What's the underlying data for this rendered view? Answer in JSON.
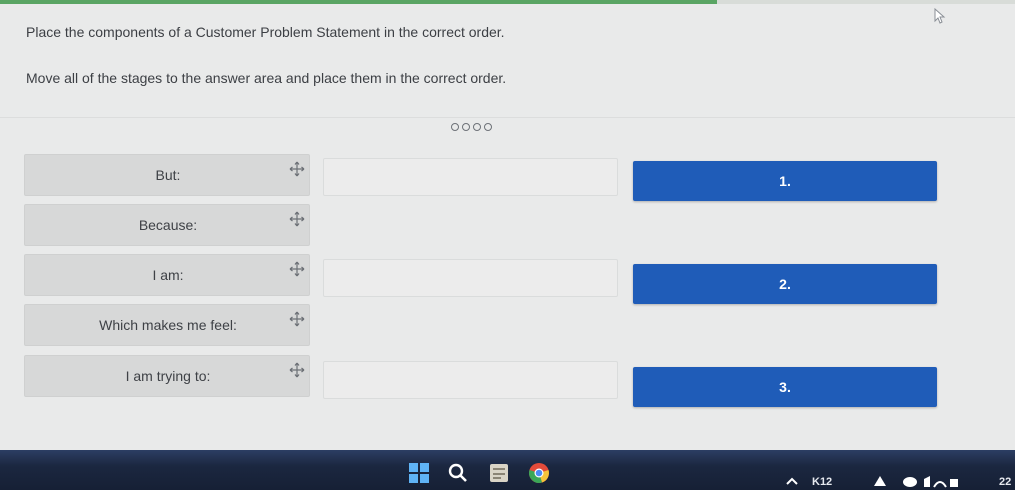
{
  "header": {
    "question": "Place the components of a Customer Problem Statement in the correct order.",
    "instruction": "Move all of the stages to the answer area and place them in the correct order."
  },
  "progress": {
    "fraction": 0.706
  },
  "pager": {
    "dots": 4
  },
  "drag_items": [
    {
      "label": "But:"
    },
    {
      "label": "Because:"
    },
    {
      "label": "I am:"
    },
    {
      "label": "Which makes me feel:"
    },
    {
      "label": "I am trying to:"
    }
  ],
  "answer_slots": [
    {
      "label": "1."
    },
    {
      "label": "2."
    },
    {
      "label": "3."
    }
  ],
  "taskbar": {
    "tray_label": "K12",
    "clock": "22"
  },
  "colors": {
    "accent": "#1f5cb8",
    "progress": "#5aa564",
    "item_bg": "#d7d8d8"
  }
}
